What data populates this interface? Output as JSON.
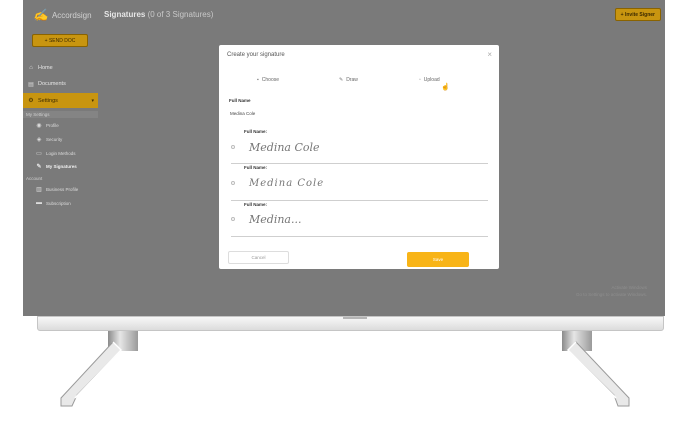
{
  "app": {
    "logo_text": "Accordsign",
    "page_title": "Signatures",
    "page_count": "(0 of 3 Signatures)",
    "top_button": "+ Invite Signer"
  },
  "sidebar": {
    "primary_button": "+ SEND DOC",
    "items": [
      {
        "label": "Home",
        "icon": "home-icon"
      },
      {
        "label": "Documents",
        "icon": "document-icon"
      },
      {
        "label": "Settings",
        "icon": "gear-icon"
      }
    ],
    "section_settings": "My Settings",
    "settings_items": [
      {
        "label": "Profile",
        "icon": "user-icon"
      },
      {
        "label": "Security",
        "icon": "shield-icon"
      },
      {
        "label": "Login Methods",
        "icon": "key-icon"
      },
      {
        "label": "My Signatures",
        "icon": "pen-icon"
      }
    ],
    "section_account": "Account",
    "account_items": [
      {
        "label": "Business Profile",
        "icon": "building-icon"
      },
      {
        "label": "Subscription",
        "icon": "card-icon"
      }
    ]
  },
  "modal": {
    "title": "Create your signature",
    "close": "×",
    "tabs": [
      {
        "label": "Choose",
        "icon": "grid-icon"
      },
      {
        "label": "Draw",
        "icon": "pencil-icon"
      },
      {
        "label": "Upload",
        "icon": "upload-icon"
      }
    ],
    "full_name_label": "Full Name",
    "full_name_value": "Medina Cole",
    "options": [
      {
        "label": "Full Name:",
        "signature": "Medina Cole"
      },
      {
        "label": "Full Name:",
        "signature": "Medina Cole"
      },
      {
        "label": "Full Name:",
        "signature": "Medina..."
      }
    ],
    "cancel": "Cancel",
    "save": "Save"
  },
  "watermark": {
    "line1": "Activate Windows",
    "line2": "Go to Settings to activate Windows."
  },
  "colors": {
    "accent": "#f8b417",
    "overlay": "#7a7a7a",
    "modal_bg": "#ffffff"
  }
}
